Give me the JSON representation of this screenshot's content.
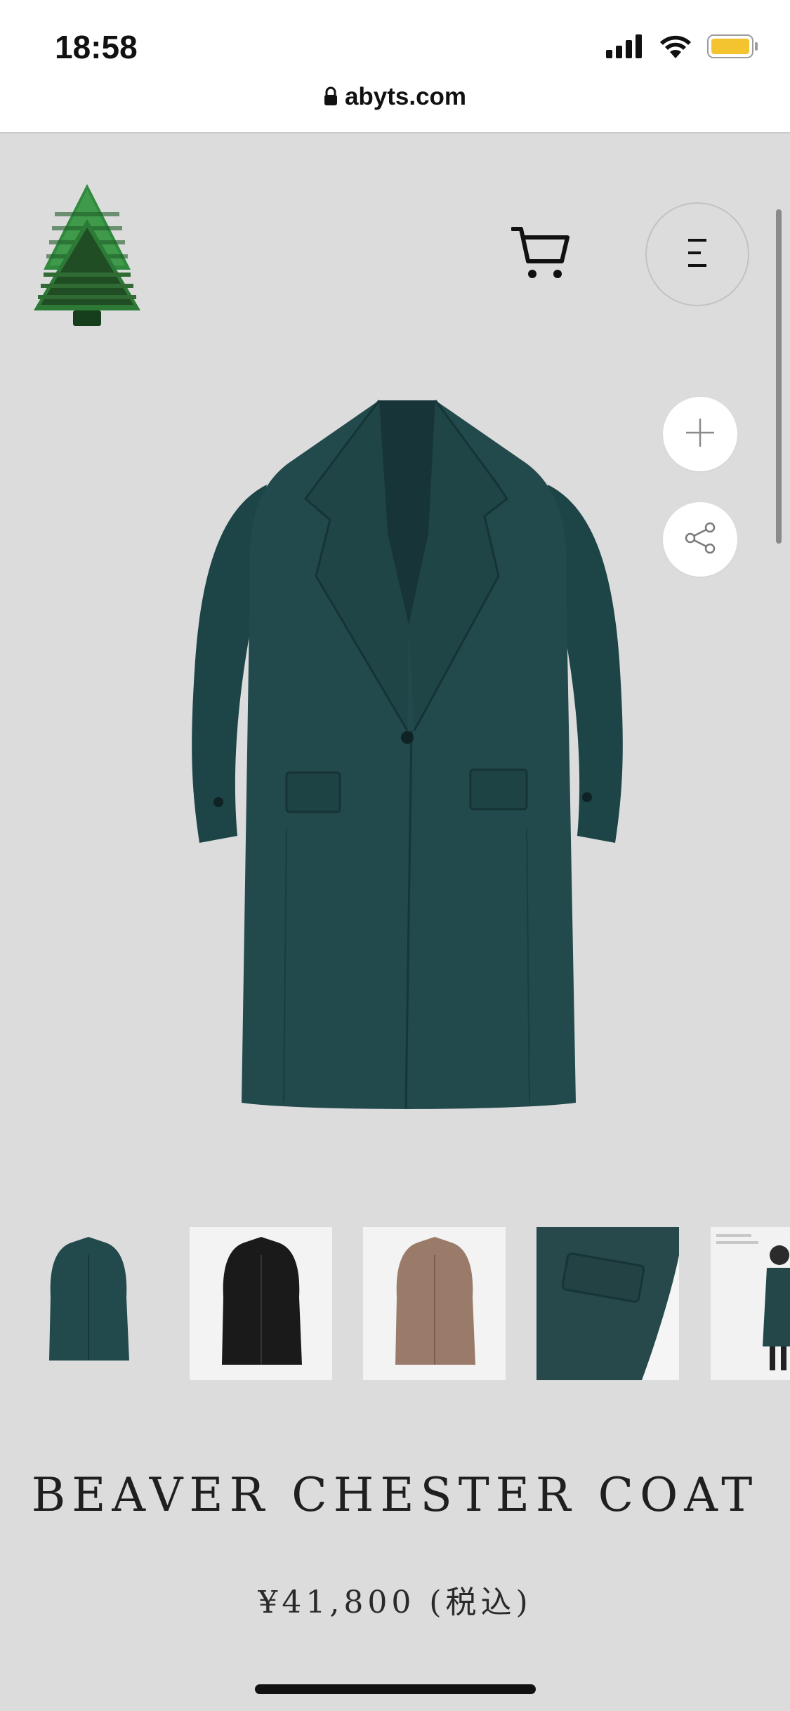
{
  "status_bar": {
    "time": "18:58",
    "icons": [
      "cellular-signal-icon",
      "wifi-icon",
      "battery-icon"
    ],
    "battery_color": "#f4c430"
  },
  "browser": {
    "url": "abyts.com",
    "lock_icon": "lock-icon"
  },
  "header": {
    "logo_icon": "tree-logo-icon",
    "cart_icon": "cart-icon",
    "menu_icon": "menu-icon"
  },
  "product": {
    "title": "BEAVER CHESTER COAT",
    "price": "¥41,800 (税込)",
    "main_color": "#1f4a4c",
    "actions": [
      "plus-icon",
      "share-icon"
    ],
    "thumbnails": [
      {
        "name": "green-coat-thumb",
        "color": "#224a4c"
      },
      {
        "name": "black-coat-thumb",
        "color": "#1a1a1a"
      },
      {
        "name": "beige-coat-thumb",
        "color": "#9a7b6a"
      },
      {
        "name": "pocket-detail-thumb",
        "color": "#27494b"
      },
      {
        "name": "model-thumb",
        "color": "#24484a"
      }
    ]
  }
}
